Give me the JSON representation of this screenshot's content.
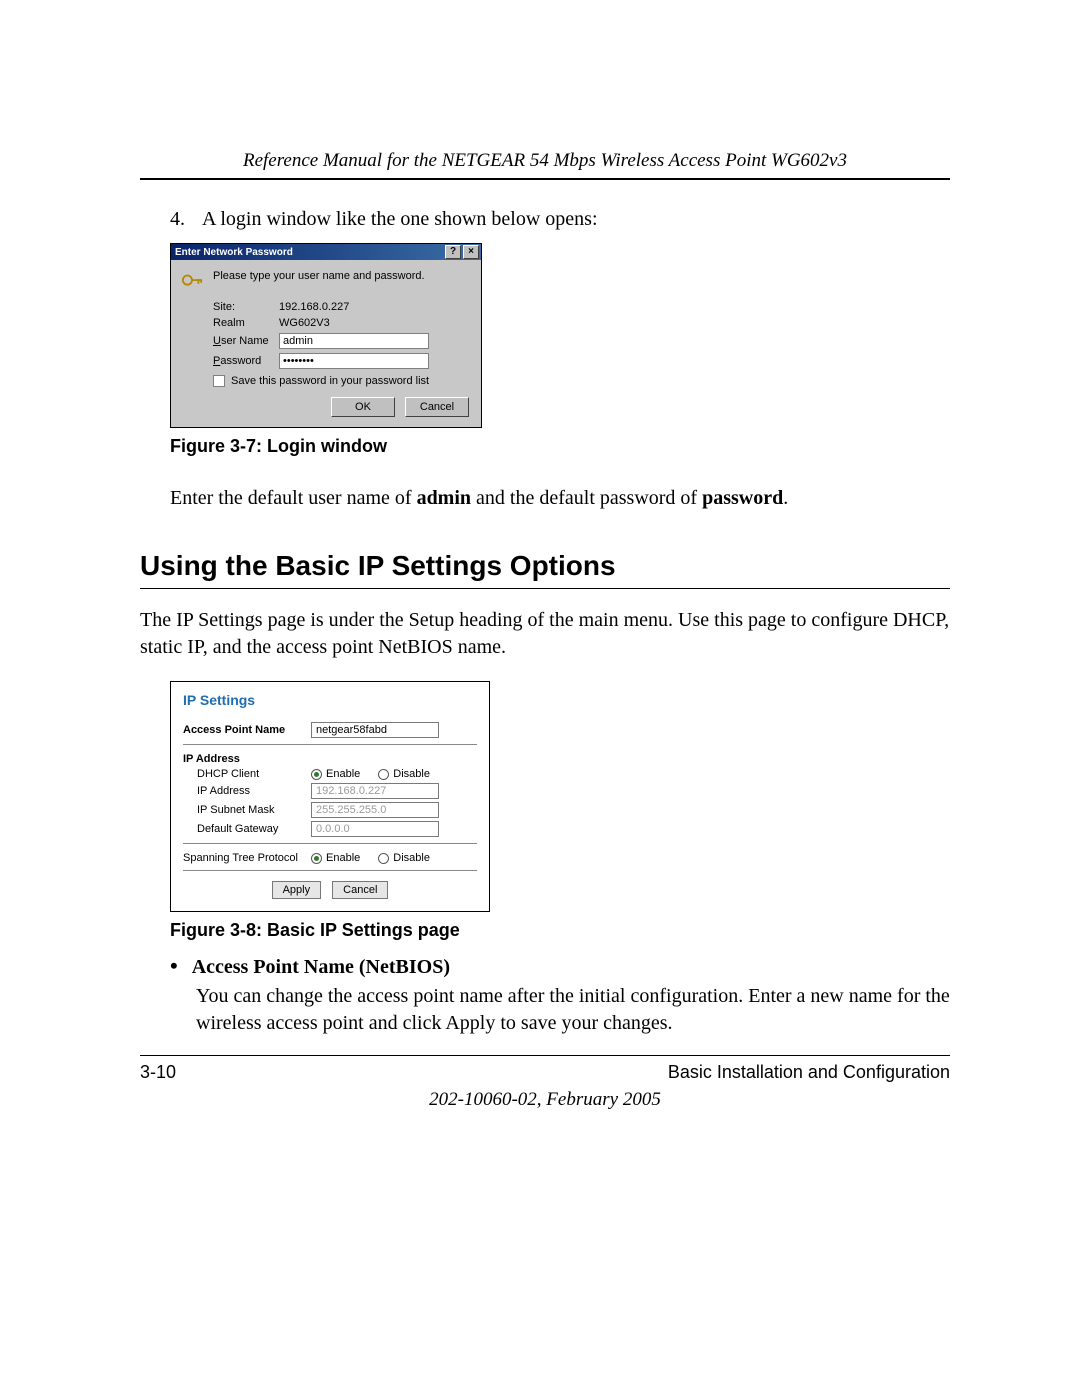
{
  "running_head": "Reference Manual for the NETGEAR 54 Mbps Wireless Access Point WG602v3",
  "step4": {
    "num": "4.",
    "text": "A login window like the one shown below opens:"
  },
  "fig37": {
    "caption": "Figure 3-7:  Login window"
  },
  "dialog37": {
    "title": "Enter Network Password",
    "help": "?",
    "close": "×",
    "prompt": "Please type your user name and password.",
    "site_label": "Site:",
    "site_value": "192.168.0.227",
    "realm_label": "Realm",
    "realm_value": "WG602V3",
    "user_pre": "U",
    "user_label_rest": "ser Name",
    "user_value": "admin",
    "pass_pre": "P",
    "pass_label_rest": "assword",
    "pass_value": "********",
    "save_pre": "S",
    "save_rest": "ave this password in your password list",
    "ok": "OK",
    "cancel": "Cancel"
  },
  "after_login_pre": "Enter the default user name of ",
  "after_login_b1": "admin",
  "after_login_mid": " and the default password of ",
  "after_login_b2": "password",
  "after_login_post": ".",
  "section_heading": "Using the Basic IP Settings Options",
  "section_para": "The IP Settings page is under the Setup heading of the main menu. Use this page to configure DHCP, static IP, and the access point NetBIOS name.",
  "panel38": {
    "title": "IP Settings",
    "ap_label": "Access Point Name",
    "ap_value": "netgear58fabd",
    "ip_hdr": "IP Address",
    "dhcp_label": "DHCP Client",
    "dhcp_enable": "Enable",
    "dhcp_disable": "Disable",
    "ip_label": "IP Address",
    "ip_value": "192.168.0.227",
    "mask_label": "IP Subnet Mask",
    "mask_value": "255.255.255.0",
    "gw_label": "Default Gateway",
    "gw_value": "0.0.0.0",
    "stp_label": "Spanning Tree Protocol",
    "stp_enable": "Enable",
    "stp_disable": "Disable",
    "apply": "Apply",
    "cancel": "Cancel"
  },
  "fig38": {
    "caption": "Figure 3-8:  Basic IP Settings page"
  },
  "bullet": {
    "dot": "•",
    "head": "Access Point Name (NetBIOS)",
    "body": "You can change the access point name after the initial configuration. Enter a new name for the wireless access point and click Apply to save your changes."
  },
  "footer": {
    "left": "3-10",
    "right": "Basic Installation and Configuration",
    "pub": "202-10060-02, February 2005"
  }
}
